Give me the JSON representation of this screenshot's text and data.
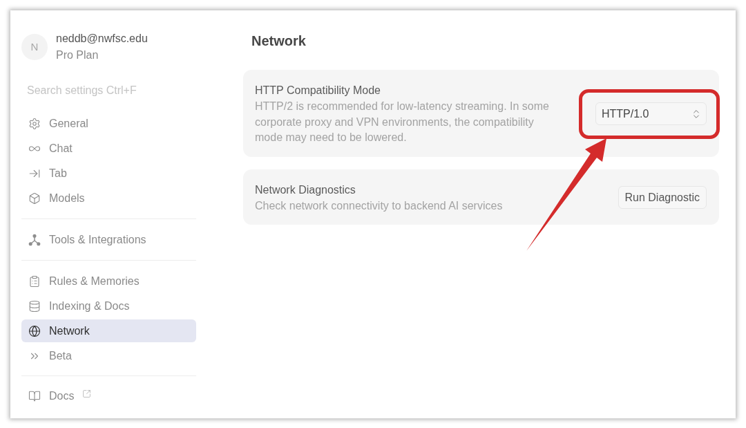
{
  "account": {
    "initial": "N",
    "email": "neddb@nwfsc.edu",
    "plan": "Pro Plan"
  },
  "search": {
    "placeholder": "Search settings Ctrl+F"
  },
  "sidebar": {
    "groups": [
      {
        "items": [
          {
            "label": "General",
            "selected": false
          },
          {
            "label": "Chat",
            "selected": false
          },
          {
            "label": "Tab",
            "selected": false
          },
          {
            "label": "Models",
            "selected": false
          }
        ]
      },
      {
        "items": [
          {
            "label": "Tools & Integrations",
            "selected": false
          }
        ]
      },
      {
        "items": [
          {
            "label": "Rules & Memories",
            "selected": false
          },
          {
            "label": "Indexing & Docs",
            "selected": false
          },
          {
            "label": "Network",
            "selected": true
          },
          {
            "label": "Beta",
            "selected": false
          }
        ]
      }
    ],
    "footer_link": {
      "label": "Docs",
      "external": true
    }
  },
  "page_title": "Network",
  "settings": [
    {
      "kind": "select",
      "title": "HTTP Compatibility Mode",
      "description": "HTTP/2 is recommended for low-latency streaming. In some corporate proxy and VPN environments, the compatibility mode may need to be lowered.",
      "value": "HTTP/1.0",
      "highlighted": true
    },
    {
      "kind": "button",
      "title": "Network Diagnostics",
      "description": "Check network connectivity to backend AI services",
      "action": "Run Diagnostic",
      "highlighted": false
    }
  ]
}
